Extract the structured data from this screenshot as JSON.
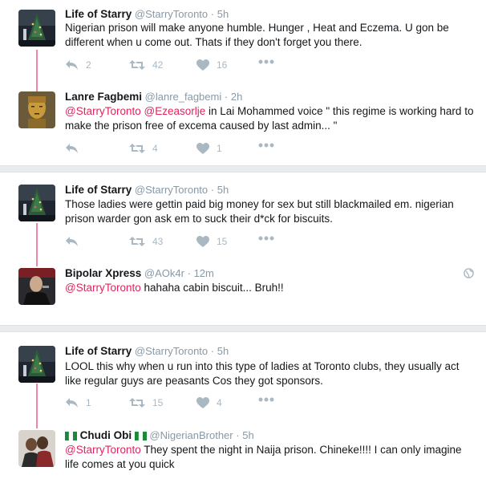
{
  "threads": [
    {
      "parent": {
        "name": "Life of Starry",
        "handle": "@StarryToronto",
        "dot": "·",
        "time": "5h",
        "text": "Nigerian prison will make anyone humble. Hunger , Heat and Eczema. U gon be different when u come out. Thats if they don't forget you there.",
        "reply_count": "2",
        "retweet_count": "42",
        "like_count": "16"
      },
      "reply": {
        "name": "Lanre Fagbemi",
        "handle": "@lanre_fagbemi",
        "dot": "·",
        "time": "2h",
        "mention1": "@StarryToronto",
        "mention2": "@Ezeasorlje",
        "text": " in  Lai Mohammed voice \" this regime  is working hard to make the prison free of excema caused by last admin... \"",
        "reply_count": "",
        "retweet_count": "4",
        "like_count": "1"
      }
    },
    {
      "parent": {
        "name": "Life of Starry",
        "handle": "@StarryToronto",
        "dot": "·",
        "time": "5h",
        "text": "Those ladies were gettin paid big money for sex but still blackmailed em. nigerian prison warder gon ask em to suck their d*ck for biscuits.",
        "reply_count": "",
        "retweet_count": "43",
        "like_count": "15"
      },
      "reply": {
        "name": "Bipolar Xpress",
        "handle": "@AOk4r",
        "dot": "·",
        "time": "12m",
        "mention1": "@StarryToronto",
        "text": " hahaha cabin biscuit... Bruh!!"
      }
    },
    {
      "parent": {
        "name": "Life of Starry",
        "handle": "@StarryToronto",
        "dot": "·",
        "time": "5h",
        "text": "LOOL this why when u run into this type of ladies at Toronto clubs, they usually act like regular guys are peasants Cos they got sponsors.",
        "reply_count": "1",
        "retweet_count": "15",
        "like_count": "4"
      },
      "reply": {
        "name": "Chudi Obi",
        "handle": "@NigerianBrother",
        "dot": "·",
        "time": "5h",
        "mention1": "@StarryToronto",
        "text": " They spent the night in Naija prison. Chineke!!!! I can only imagine life comes at you quick"
      }
    }
  ],
  "icons": {
    "reply": "reply-icon",
    "retweet": "retweet-icon",
    "like": "heart-icon",
    "more": "more-icon",
    "globe": "globe-icon",
    "flag": "nigeria-flag-icon"
  },
  "colors": {
    "mention": "#e0245e",
    "connector": "#e0245e",
    "muted": "#8899a6",
    "icon": "#aab8c2",
    "separator": "#e8ecef"
  }
}
